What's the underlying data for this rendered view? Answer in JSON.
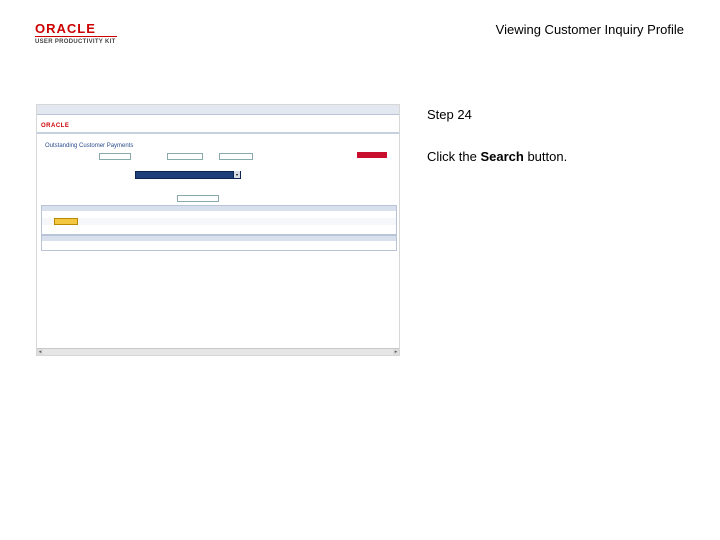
{
  "header": {
    "title": "Viewing Customer Inquiry Profile"
  },
  "logo": {
    "brand": "ORACLE",
    "subtitle": "USER PRODUCTIVITY KIT"
  },
  "step": {
    "label": "Step 24"
  },
  "instruction": {
    "prefix": "Click the ",
    "target": "Search",
    "suffix": " button."
  },
  "screenshot": {
    "brand": "ORACLE",
    "page_title": "Outstanding Customer Payments",
    "colors": {
      "accent": "#c8102e",
      "nav": "#2b4e8c",
      "highlight": "#f3c742"
    }
  }
}
